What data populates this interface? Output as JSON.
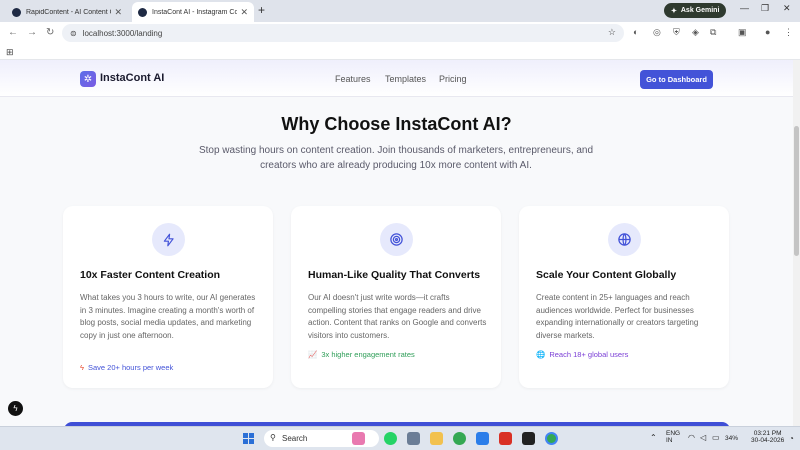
{
  "browser": {
    "tabs": [
      {
        "title": "RapidContent - AI Content Gen",
        "active": false
      },
      {
        "title": "InstaCont AI - Instagram Conte",
        "active": true
      }
    ],
    "gemini_label": "Ask Gemini",
    "url": "localhost:3000/landing"
  },
  "site": {
    "logo_text": "InstaCont AI",
    "nav": [
      "Features",
      "Templates",
      "Pricing"
    ],
    "cta": "Go to Dashboard"
  },
  "hero": {
    "title": "Why Choose InstaCont AI?",
    "subtitle": "Stop wasting hours on content creation. Join thousands of marketers, entrepreneurs, and creators who are already producing 10x more content with AI."
  },
  "cards": [
    {
      "icon": "lightning-icon",
      "title": "10x Faster Content Creation",
      "desc": "What takes you 3 hours to write, our AI generates in 3 minutes. Imagine creating a month's worth of blog posts, social media updates, and marketing copy in just one afternoon.",
      "badge": "Save 20+ hours per week",
      "badge_color": "#4353d8"
    },
    {
      "icon": "target-icon",
      "title": "Human-Like Quality That Converts",
      "desc": "Our AI doesn't just write words—it crafts compelling stories that engage readers and drive action. Content that ranks on Google and converts visitors into customers.",
      "badge": "3x higher engagement rates",
      "badge_color": "#2f9e58"
    },
    {
      "icon": "globe-icon",
      "title": "Scale Your Content Globally",
      "desc": "Create content in 25+ languages and reach audiences worldwide. Perfect for businesses expanding internationally or creators targeting diverse markets.",
      "badge": "Reach 18+ global users",
      "badge_color": "#7b3fd6"
    }
  ],
  "taskbar": {
    "search_label": "Search",
    "lang": "ENG",
    "region": "IN",
    "battery": "34%",
    "time": "03:21 PM",
    "date": "30-04-2026"
  }
}
